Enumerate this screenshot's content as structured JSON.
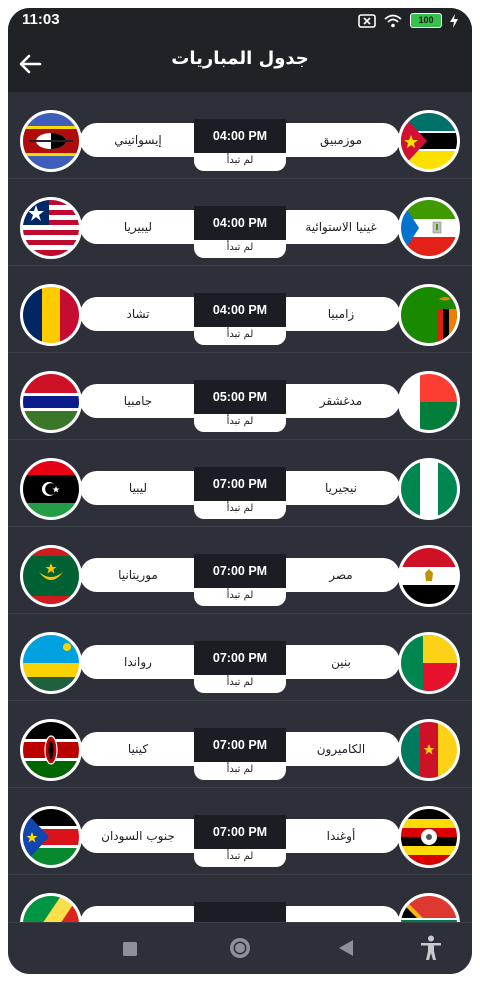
{
  "status_bar": {
    "time": "11:03",
    "battery": "100"
  },
  "header": {
    "title": "جدول المباريات"
  },
  "matches": [
    {
      "home": "موزمبيق",
      "away": "إيسواتيني",
      "time": "04:00 PM",
      "status": "لم تبدأ",
      "home_flag": "mozambique-flag-icon",
      "away_flag": "eswatini-flag-icon"
    },
    {
      "home": "غينيا الاستوائية",
      "away": "ليبيريا",
      "time": "04:00 PM",
      "status": "لم تبدأ",
      "home_flag": "equatorial-guinea-flag-icon",
      "away_flag": "liberia-flag-icon"
    },
    {
      "home": "زامبيا",
      "away": "تشاد",
      "time": "04:00 PM",
      "status": "لم تبدأ",
      "home_flag": "zambia-flag-icon",
      "away_flag": "chad-flag-icon"
    },
    {
      "home": "مدغشقر",
      "away": "جامبيا",
      "time": "05:00 PM",
      "status": "لم تبدأ",
      "home_flag": "madagascar-flag-icon",
      "away_flag": "gambia-flag-icon"
    },
    {
      "home": "نيجيريا",
      "away": "ليبيا",
      "time": "07:00 PM",
      "status": "لم تبدأ",
      "home_flag": "nigeria-flag-icon",
      "away_flag": "libya-flag-icon"
    },
    {
      "home": "مصر",
      "away": "موريتانيا",
      "time": "07:00 PM",
      "status": "لم تبدأ",
      "home_flag": "egypt-flag-icon",
      "away_flag": "mauritania-flag-icon"
    },
    {
      "home": "بنين",
      "away": "رواندا",
      "time": "07:00 PM",
      "status": "لم تبدأ",
      "home_flag": "benin-flag-icon",
      "away_flag": "rwanda-flag-icon"
    },
    {
      "home": "الكاميرون",
      "away": "كينيا",
      "time": "07:00 PM",
      "status": "لم تبدأ",
      "home_flag": "cameroon-flag-icon",
      "away_flag": "kenya-flag-icon"
    },
    {
      "home": "أوغندا",
      "away": "جنوب السودان",
      "time": "07:00 PM",
      "status": "لم تبدأ",
      "home_flag": "uganda-flag-icon",
      "away_flag": "south-sudan-flag-icon"
    },
    {
      "home": "",
      "away": "",
      "time": "",
      "status": "",
      "home_flag": "south-africa-flag-icon",
      "away_flag": "congo-flag-icon"
    }
  ],
  "nav": {
    "recents": "recents-square-icon",
    "home": "home-circle-icon",
    "back": "back-triangle-icon",
    "accessibility": "accessibility-icon"
  }
}
